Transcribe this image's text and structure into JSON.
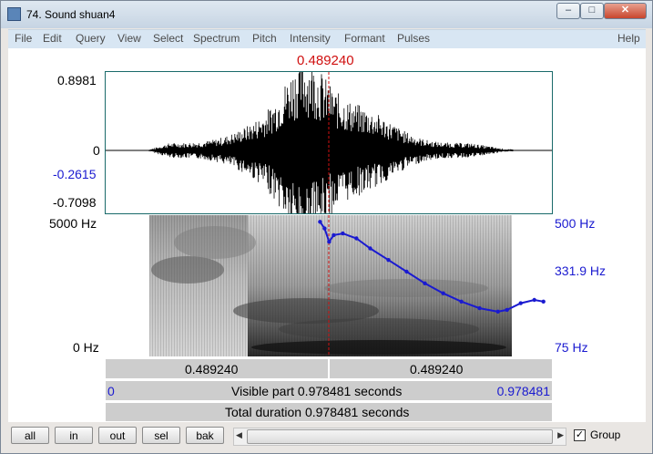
{
  "window": {
    "title": "74. Sound shuan4",
    "minimize": "–",
    "maximize": "□",
    "close": "✕"
  },
  "menu": [
    "File",
    "Edit",
    "Query",
    "View",
    "Select",
    "Spectrum",
    "Pitch",
    "Intensity",
    "Formant",
    "Pulses"
  ],
  "help": "Help",
  "cursor_time": "0.489240",
  "waveform": {
    "ymax": "0.8981",
    "zero": "0",
    "cursor_value": "-0.2615",
    "ymin": "-0.7098"
  },
  "spectrogram": {
    "freq_max": "5000 Hz",
    "freq_min": "0 Hz",
    "pitch_max": "500 Hz",
    "pitch_cursor": "331.9 Hz",
    "pitch_min": "75 Hz"
  },
  "time_bar": {
    "left": "0.489240",
    "right": "0.489240"
  },
  "visible_bar": {
    "start": "0",
    "text": "Visible part 0.978481 seconds",
    "end": "0.978481"
  },
  "total_bar": {
    "text": "Total duration 0.978481 seconds"
  },
  "buttons": [
    "all",
    "in",
    "out",
    "sel",
    "bak"
  ],
  "group": {
    "label": "Group",
    "checked": true
  },
  "colors": {
    "cursor": "#d01010",
    "pitch": "#1a1ad0",
    "bar": "#cdcdcd"
  },
  "chart_data": {
    "type": "line",
    "series": [
      {
        "x": [
          0.47,
          0.48,
          0.49,
          0.5,
          0.52,
          0.55,
          0.58,
          0.62,
          0.66,
          0.7,
          0.74,
          0.78,
          0.82,
          0.86,
          0.88,
          0.91,
          0.94,
          0.96
        ],
        "values": [
          480,
          460,
          420,
          440,
          445,
          430,
          400,
          365,
          330,
          295,
          265,
          240,
          220,
          210,
          215,
          235,
          245,
          240
        ]
      }
    ],
    "xlim": [
      0,
      0.978481
    ],
    "ylim": [
      75,
      500
    ],
    "ylabel": "Hz"
  }
}
